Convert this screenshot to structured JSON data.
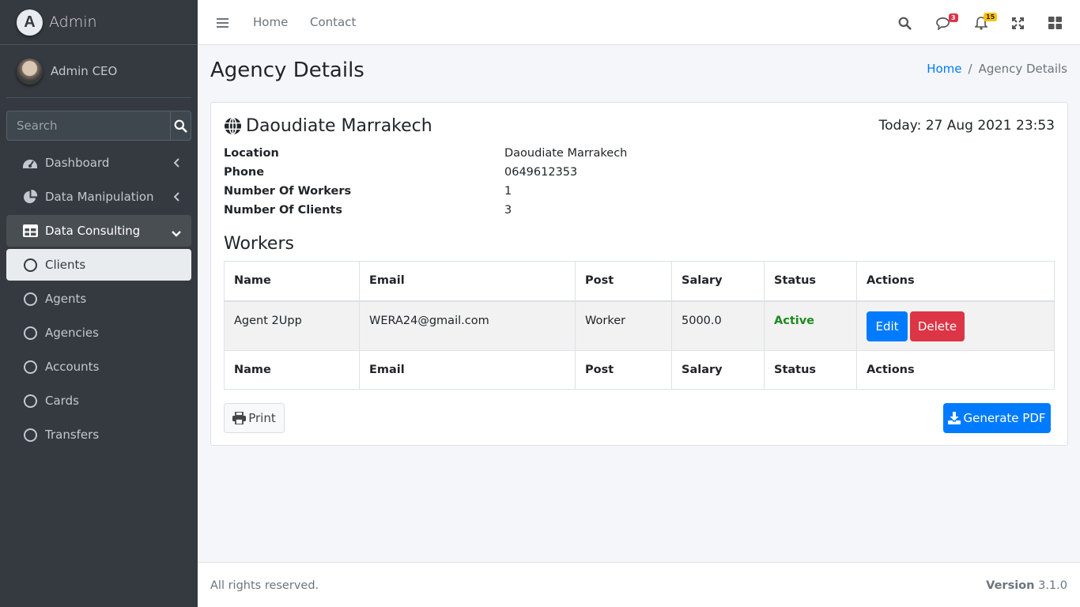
{
  "brand": {
    "letter": "A",
    "name": "Admin"
  },
  "user": {
    "name": "Admin CEO"
  },
  "sidebar": {
    "search_placeholder": "Search",
    "items": [
      {
        "label": "Dashboard",
        "icon": "tachometer-icon"
      },
      {
        "label": "Data Manipulation",
        "icon": "pie-chart-icon"
      },
      {
        "label": "Data Consulting",
        "icon": "table-icon"
      },
      {
        "label": "Clients",
        "icon": "circle-icon"
      },
      {
        "label": "Agents",
        "icon": "circle-icon"
      },
      {
        "label": "Agencies",
        "icon": "circle-icon"
      },
      {
        "label": "Accounts",
        "icon": "circle-icon"
      },
      {
        "label": "Cards",
        "icon": "circle-icon"
      },
      {
        "label": "Transfers",
        "icon": "circle-icon"
      }
    ]
  },
  "topbar": {
    "links": [
      "Home",
      "Contact"
    ],
    "messages_count": "3",
    "notifications_count": "15"
  },
  "page": {
    "title": "Agency Details",
    "breadcrumb": {
      "home": "Home",
      "separator": "/",
      "current": "Agency Details"
    }
  },
  "agency": {
    "name": "Daoudiate Marrakech",
    "today": "Today: 27 Aug 2021 23:53",
    "fields": [
      {
        "label": "Location",
        "value": "Daoudiate Marrakech"
      },
      {
        "label": "Phone",
        "value": "0649612353"
      },
      {
        "label": "Number Of Workers",
        "value": "1"
      },
      {
        "label": "Number Of Clients",
        "value": "3"
      }
    ]
  },
  "workers": {
    "title": "Workers",
    "columns": [
      "Name",
      "Email",
      "Post",
      "Salary",
      "Status",
      "Actions"
    ],
    "rows": [
      {
        "name": "Agent 2Upp",
        "email": "WERA24@gmail.com",
        "post": "Worker",
        "salary": "5000.0",
        "status": "Active",
        "edit": "Edit",
        "delete": "Delete"
      }
    ]
  },
  "buttons": {
    "print": "Print",
    "pdf": "Generate PDF"
  },
  "footer": {
    "left": "All rights reserved.",
    "version_label": "Version",
    "version": "3.1.0"
  },
  "colors": {
    "sidebar_bg": "#343a40",
    "primary": "#007bff",
    "danger": "#dc3545",
    "success": "#1e8a1e",
    "msg_badge": "#dc3545",
    "notif_badge": "#ffc107"
  }
}
